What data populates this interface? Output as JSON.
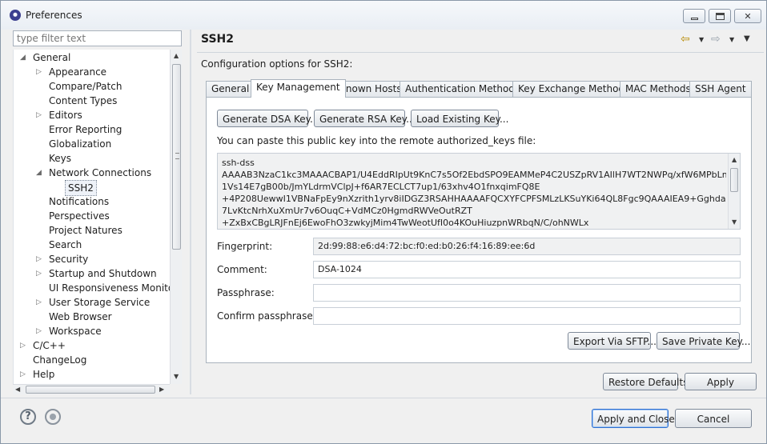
{
  "window": {
    "title": "Preferences"
  },
  "filter": {
    "placeholder": "type filter text"
  },
  "tree": [
    {
      "label": "General",
      "level": 0,
      "state": "expanded"
    },
    {
      "label": "Appearance",
      "level": 1,
      "state": "collapsed"
    },
    {
      "label": "Compare/Patch",
      "level": 1,
      "state": "leaf"
    },
    {
      "label": "Content Types",
      "level": 1,
      "state": "leaf"
    },
    {
      "label": "Editors",
      "level": 1,
      "state": "collapsed"
    },
    {
      "label": "Error Reporting",
      "level": 1,
      "state": "leaf"
    },
    {
      "label": "Globalization",
      "level": 1,
      "state": "leaf"
    },
    {
      "label": "Keys",
      "level": 1,
      "state": "leaf"
    },
    {
      "label": "Network Connections",
      "level": 1,
      "state": "expanded"
    },
    {
      "label": "SSH2",
      "level": 2,
      "state": "leaf",
      "selected": true
    },
    {
      "label": "Notifications",
      "level": 1,
      "state": "leaf"
    },
    {
      "label": "Perspectives",
      "level": 1,
      "state": "leaf"
    },
    {
      "label": "Project Natures",
      "level": 1,
      "state": "leaf"
    },
    {
      "label": "Search",
      "level": 1,
      "state": "leaf"
    },
    {
      "label": "Security",
      "level": 1,
      "state": "collapsed"
    },
    {
      "label": "Startup and Shutdown",
      "level": 1,
      "state": "collapsed"
    },
    {
      "label": "UI Responsiveness Monitorin",
      "level": 1,
      "state": "leaf"
    },
    {
      "label": "User Storage Service",
      "level": 1,
      "state": "collapsed"
    },
    {
      "label": "Web Browser",
      "level": 1,
      "state": "leaf"
    },
    {
      "label": "Workspace",
      "level": 1,
      "state": "collapsed"
    },
    {
      "label": "C/C++",
      "level": 0,
      "state": "collapsed"
    },
    {
      "label": "ChangeLog",
      "level": 0,
      "state": "leaf"
    },
    {
      "label": "Help",
      "level": 0,
      "state": "collapsed"
    }
  ],
  "page": {
    "title": "SSH2",
    "description": "Configuration options for SSH2:"
  },
  "tabs": [
    "General",
    "Key Management",
    "Known Hosts",
    "Authentication Methods",
    "Key Exchange Methods",
    "MAC Methods",
    "SSH Agent"
  ],
  "active_tab": "Key Management",
  "key_management": {
    "generate_dsa": "Generate DSA Key...",
    "generate_rsa": "Generate RSA Key...",
    "load_existing": "Load Existing Key...",
    "hint": "You can paste this public key into the remote authorized_keys file:",
    "public_key": "ssh-dss\nAAAAB3NzaC1kc3MAAACBAP1/U4EddRIpUt9KnC7s5Of2EbdSPO9EAMMeP4C2USZpRV1AIlH7WT2NWPq/xfW6MPbLm\n1Vs14E7gB00b/JmYLdrmVClpJ+f6AR7ECLCT7up1/63xhv4O1fnxqimFQ8E\n+4P208UewwI1VBNaFpEy9nXzrith1yrv8iIDGZ3RSAHHAAAAFQCXYFCPFSMLzLKSuYKi64QL8Fgc9QAAAIEA9+GghdabPd\n7LvKtcNrhXuXmUr7v6OuqC+VdMCz0HgmdRWVeOutRZT\n+ZxBxCBgLRJFnEj6EwoFhO3zwkyjMim4TwWeotUfI0o4KOuHiuzpnWRbqN/C/ohNWLx",
    "fingerprint_label": "Fingerprint:",
    "fingerprint": "2d:99:88:e6:d4:72:bc:f0:ed:b0:26:f4:16:89:ee:6d",
    "comment_label": "Comment:",
    "comment": "DSA-1024",
    "passphrase_label": "Passphrase:",
    "passphrase": "",
    "confirm_label": "Confirm passphrase:",
    "confirm": "",
    "export_sftp": "Export Via SFTP...",
    "save_private": "Save Private Key..."
  },
  "buttons": {
    "restore_defaults": "Restore Defaults",
    "apply": "Apply",
    "apply_close": "Apply and Close",
    "cancel": "Cancel"
  },
  "icons": {
    "help": "?",
    "back": "⇦",
    "forward": "⇨"
  },
  "colors": {
    "selection_border": "#2f6fd0",
    "back_arrow": "#b88a00"
  }
}
